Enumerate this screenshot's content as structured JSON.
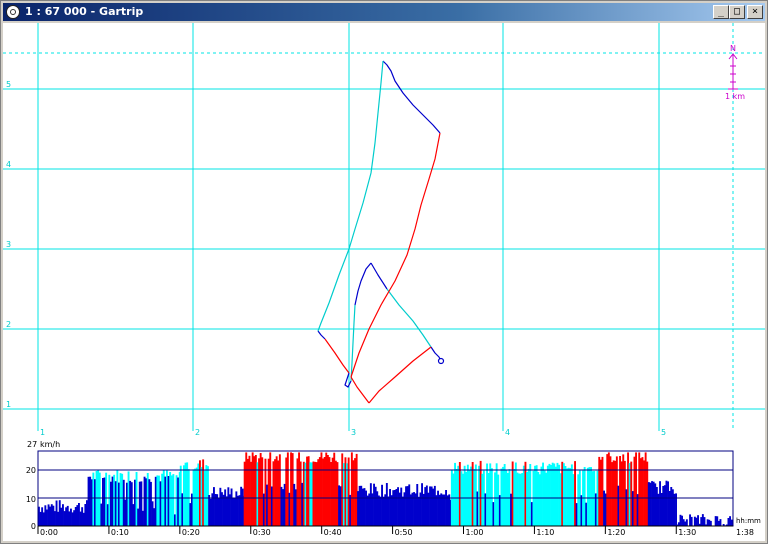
{
  "window": {
    "title": "1 : 67 000 - Gartrip",
    "minimize_glyph": "_",
    "maximize_glyph": "□",
    "close_glyph": "×"
  },
  "map": {
    "x_labels": [
      "1",
      "2",
      "3",
      "4",
      "5"
    ],
    "y_labels": [
      "5",
      "4",
      "3",
      "2",
      "1"
    ],
    "north_label": "N",
    "scale_label": "1 km",
    "grid_color": "#00e5e5",
    "colors": {
      "slow": "#0000cc",
      "medium": "#00ffff",
      "fast": "#ff0000",
      "north": "#cc00cc"
    }
  },
  "speed_chart": {
    "unit_label": "km/h",
    "y_max_label": "27",
    "y_tick_labels": [
      "20",
      "10",
      "0"
    ],
    "x_tick_labels": [
      "0:00",
      "0:10",
      "0:20",
      "0:30",
      "0:40",
      "0:50",
      "1:00",
      "1:10",
      "1:20",
      "1:30"
    ],
    "end_label": "1:38",
    "time_unit_label": "hh:mm"
  },
  "chart_data": {
    "type": "area",
    "title": "",
    "xlabel": "hh:mm",
    "ylabel": "km/h",
    "ylim": [
      0,
      27
    ],
    "xlim": [
      "0:00",
      "1:38"
    ],
    "grid": true,
    "speed_bands": [
      {
        "color": "blue",
        "range_kmh": "0-18"
      },
      {
        "color": "cyan",
        "range_kmh": "18-23"
      },
      {
        "color": "red",
        "range_kmh": "23+"
      }
    ],
    "segments": [
      {
        "from": "0:00",
        "to": "0:07",
        "avg_kmh": 7
      },
      {
        "from": "0:07",
        "to": "0:20",
        "avg_kmh": 18
      },
      {
        "from": "0:20",
        "to": "0:24",
        "avg_kmh": 22
      },
      {
        "from": "0:24",
        "to": "0:29",
        "avg_kmh": 12
      },
      {
        "from": "0:29",
        "to": "0:45",
        "avg_kmh": 25
      },
      {
        "from": "0:45",
        "to": "0:58",
        "avg_kmh": 13
      },
      {
        "from": "0:58",
        "to": "1:19",
        "avg_kmh": 21
      },
      {
        "from": "1:19",
        "to": "1:26",
        "avg_kmh": 25
      },
      {
        "from": "1:26",
        "to": "1:30",
        "avg_kmh": 14
      },
      {
        "from": "1:30",
        "to": "1:38",
        "avg_kmh": 2
      }
    ]
  }
}
